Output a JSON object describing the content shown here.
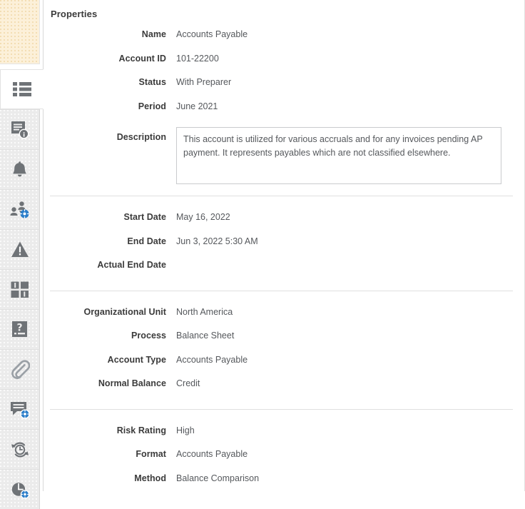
{
  "panel": {
    "title": "Properties"
  },
  "rail": {
    "tabs": [
      {
        "name": "properties",
        "icon": "list-icon",
        "active": true
      },
      {
        "name": "instructions",
        "icon": "document-info-icon",
        "active": false
      },
      {
        "name": "alerts",
        "icon": "bell-icon",
        "active": false
      },
      {
        "name": "reassign",
        "icon": "user-reassign-icon",
        "active": false
      },
      {
        "name": "warnings",
        "icon": "warning-triangle-icon",
        "active": false
      },
      {
        "name": "attributes",
        "icon": "attributes-grid-icon",
        "active": false
      },
      {
        "name": "questions",
        "icon": "question-document-icon",
        "active": false
      },
      {
        "name": "attachments",
        "icon": "paperclip-icon",
        "active": false
      },
      {
        "name": "comments",
        "icon": "comment-add-icon",
        "active": false
      },
      {
        "name": "history",
        "icon": "history-clock-icon",
        "active": false
      },
      {
        "name": "workflow",
        "icon": "pie-clock-icon",
        "active": false
      }
    ]
  },
  "sections": [
    {
      "name": "identity",
      "rows": [
        {
          "label": "Name",
          "value": "Accounts Payable"
        },
        {
          "label": "Account ID",
          "value": "101-22200"
        },
        {
          "label": "Status",
          "value": "With Preparer"
        },
        {
          "label": "Period",
          "value": "June 2021"
        }
      ]
    },
    {
      "name": "description",
      "rows": [
        {
          "label": "Description",
          "value": "This account is utilized for various accruals and for any invoices pending AP payment. It represents payables which are not classified elsewhere."
        }
      ]
    },
    {
      "name": "dates",
      "rows": [
        {
          "label": "Start Date",
          "value": "May 16, 2022"
        },
        {
          "label": "End Date",
          "value": "Jun 3, 2022 5:30 AM"
        },
        {
          "label": "Actual End Date",
          "value": ""
        }
      ]
    },
    {
      "name": "classification",
      "rows": [
        {
          "label": "Organizational Unit",
          "value": "North America"
        },
        {
          "label": "Process",
          "value": "Balance Sheet"
        },
        {
          "label": "Account Type",
          "value": "Accounts Payable"
        },
        {
          "label": "Normal Balance",
          "value": "Credit"
        }
      ]
    },
    {
      "name": "risk",
      "rows": [
        {
          "label": "Risk Rating",
          "value": "High"
        },
        {
          "label": "Format",
          "value": "Accounts Payable"
        },
        {
          "label": "Method",
          "value": "Balance Comparison"
        }
      ]
    }
  ],
  "colors": {
    "accent_blue": "#2a7dc9",
    "icon_gray": "#6f7377",
    "label_text": "#3b3b3b",
    "value_text": "#55585c",
    "divider": "#e0e0e0",
    "tab_inactive_bg": "#ebebeb",
    "top_block_bg": "#fcf0d9"
  }
}
